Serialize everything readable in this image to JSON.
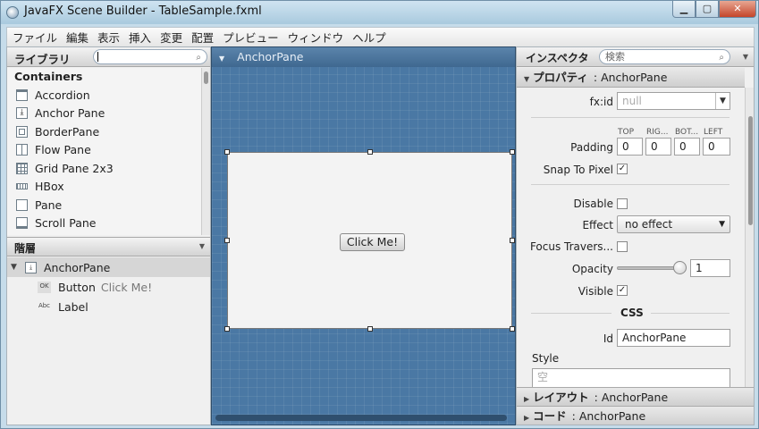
{
  "window": {
    "title": "JavaFX Scene Builder - TableSample.fxml",
    "min": "▁",
    "max": "▢",
    "close": "✕"
  },
  "menu": [
    "ファイル",
    "編集",
    "表示",
    "挿入",
    "変更",
    "配置",
    "プレビュー",
    "ウィンドウ",
    "ヘルプ"
  ],
  "library": {
    "title": "ライブラリ",
    "search_value": "",
    "category": "Containers",
    "items": [
      "Accordion",
      "Anchor Pane",
      "BorderPane",
      "Flow Pane",
      "Grid Pane 2x3",
      "HBox",
      "Pane",
      "Scroll Pane"
    ]
  },
  "hierarchy": {
    "title": "階層",
    "root": {
      "label": "AnchorPane"
    },
    "children": [
      {
        "icon": "OK",
        "label": "Button",
        "detail": "Click Me!"
      },
      {
        "icon": "Abc",
        "label": "Label",
        "detail": ""
      }
    ]
  },
  "content": {
    "breadcrumb": "AnchorPane",
    "button_label": "Click Me!"
  },
  "inspector": {
    "title": "インスペクタ",
    "search_placeholder": "検索",
    "properties_section": "プロパティ",
    "properties_target": ": AnchorPane",
    "fx_id_label": "fx:id",
    "fx_id_placeholder": "null",
    "padding_label": "Padding",
    "padding_headers": [
      "TOP",
      "RIG...",
      "BOT...",
      "LEFT"
    ],
    "padding_values": [
      "0",
      "0",
      "0",
      "0"
    ],
    "snap_label": "Snap To Pixel",
    "snap_checked": "✓",
    "disable_label": "Disable",
    "effect_label": "Effect",
    "effect_value": "no effect",
    "focus_label": "Focus Travers...",
    "opacity_label": "Opacity",
    "opacity_value": "1",
    "visible_label": "Visible",
    "visible_checked": "✓",
    "css_header": "CSS",
    "id_label": "Id",
    "id_value": "AnchorPane",
    "style_label": "Style",
    "style_placeholder": "空",
    "layout_section": "レイアウト",
    "layout_target": ": AnchorPane",
    "code_section": "コード",
    "code_target": ": AnchorPane"
  }
}
